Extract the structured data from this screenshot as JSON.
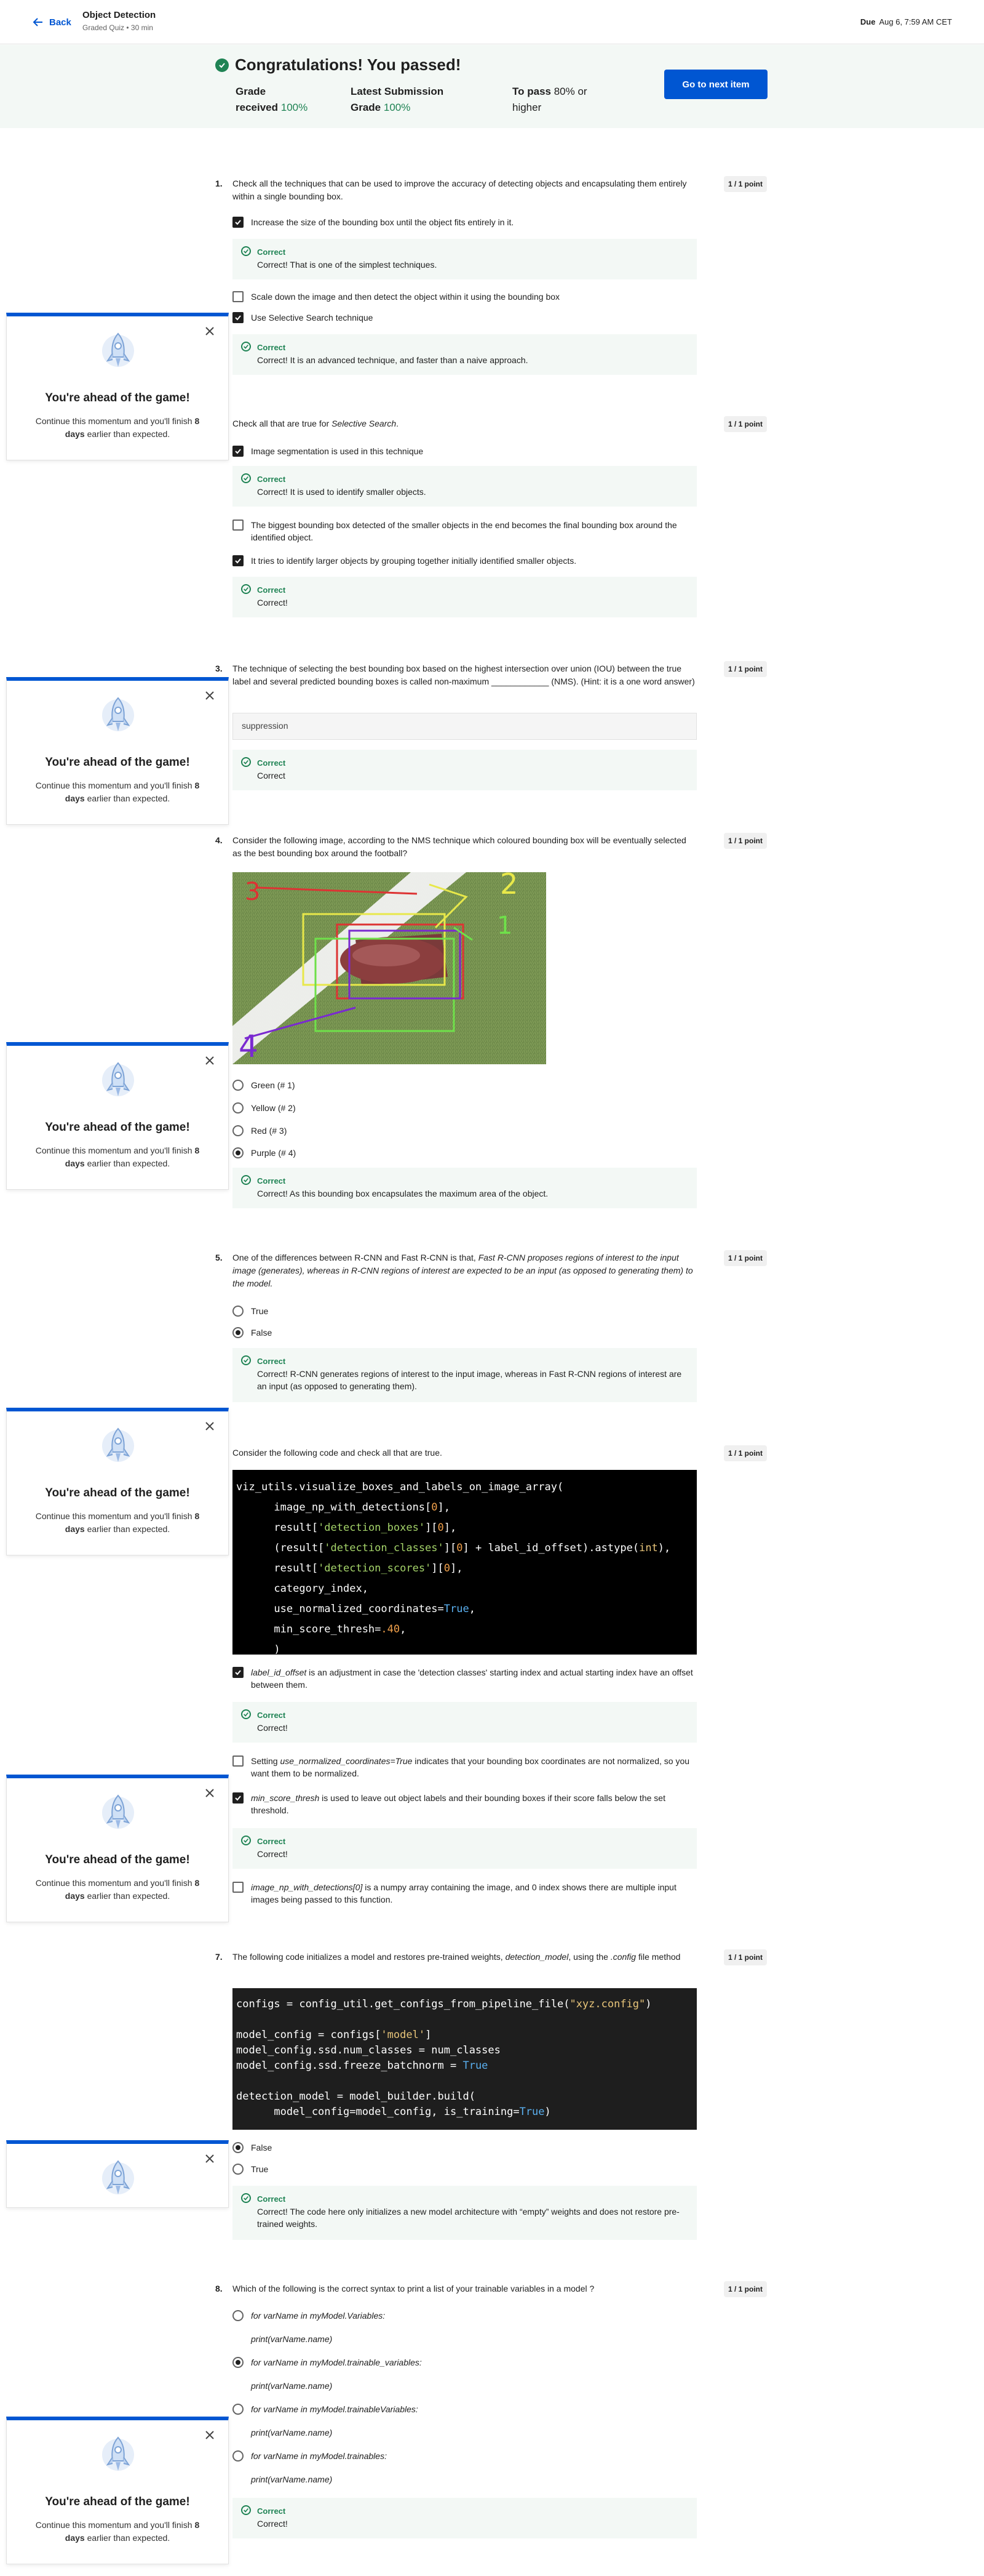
{
  "header": {
    "back_label": "Back",
    "course_title": "Object Detection",
    "course_subtitle": "Graded Quiz • 30 min",
    "due_label": "Due",
    "due_date": "Aug 6, 7:59 AM CET"
  },
  "banner": {
    "title": "Congratulations! You passed!",
    "grade_label_1": "Grade",
    "grade_label_2": "received",
    "grade_value": "100%",
    "latest_label_1": "Latest Submission",
    "latest_label_2": "Grade",
    "latest_value": "100%",
    "pass_label_1": "To pass",
    "pass_value": "80% or",
    "pass_label_2": "higher",
    "next_button": "Go to next item"
  },
  "side_card": {
    "title": "You're ahead of the game!",
    "line1": "Continue this momentum and you'll finish",
    "days": "8 days",
    "line2": "earlier than expected."
  },
  "points_label": "1 / 1 point",
  "correct_label": "Correct",
  "q1": {
    "num": "1.",
    "text": "Check all the techniques that can be used to improve the accuracy of detecting objects and encapsulating them entirely within a single bounding box.",
    "opt1": "Increase the size of the bounding box until the object fits entirely in it.",
    "fb1": "Correct! That is one of the simplest techniques.",
    "opt2": "Scale down the image and then detect the object within it using the bounding box",
    "opt3": "Use Selective Search technique",
    "fb3": "Correct! It is an advanced technique, and faster than a naive approach."
  },
  "q2": {
    "text_pre": "Check all that are true for ",
    "text_em": "Selective Search",
    "text_post": ".",
    "opt1": "Image segmentation is used in this technique",
    "fb1": "Correct! It is used to identify smaller objects.",
    "opt2": "The biggest bounding box detected of the smaller objects in the end becomes the final bounding box around the identified object.",
    "opt3": "It tries to identify larger objects by grouping together initially identified smaller objects.",
    "fb3": "Correct!"
  },
  "q3": {
    "num": "3.",
    "text": "The technique of selecting the best bounding box based on the highest intersection over union (IOU) between the true label and several predicted bounding boxes is called non-maximum ____________ (NMS). (Hint: it is a one word answer)",
    "answer": "suppression",
    "fb": "Correct"
  },
  "q4": {
    "num": "4.",
    "text": "Consider the following image, according to the NMS technique which coloured bounding box will be eventually selected as the best bounding box around the football?",
    "box_labels": [
      "1",
      "2",
      "3",
      "4"
    ],
    "opt1": "Green (# 1)",
    "opt2": "Yellow (# 2)",
    "opt3": "Red (# 3)",
    "opt4": "Purple (# 4)",
    "fb": "Correct! As this bounding box encapsulates the maximum area of the object."
  },
  "q5": {
    "num": "5.",
    "text_pre": "One of the differences between R-CNN and Fast R-CNN is that, ",
    "text_em": "Fast R-CNN proposes regions of interest to the input image (generates), whereas in R-CNN regions of interest are expected to be an input (as opposed to generating them) to the model.",
    "opt1": "True",
    "opt2": "False",
    "fb": "Correct! R-CNN generates regions of interest to the input image, whereas in Fast R-CNN regions of interest are an input (as opposed to generating them)."
  },
  "q6": {
    "text": "Consider the following code and check all that are true.",
    "opt1_em": "label_id_offset",
    "opt1": " is an adjustment in case the 'detection classes' starting index and actual starting index have an offset between them.",
    "fb1": "Correct!",
    "opt2_pre": "Setting ",
    "opt2_em": "use_normalized_coordinates=True",
    "opt2": " indicates that your bounding box coordinates are not normalized, so you want them to be normalized.",
    "opt3_em": "min_score_thresh",
    "opt3": " is used to leave out object labels and their bounding boxes if their score falls below the set threshold.",
    "fb3": "Correct!",
    "opt4_em": "image_np_with_detections[0]",
    "opt4": " is a numpy array containing the image, and 0 index shows there are multiple input images being passed to this function."
  },
  "q7": {
    "num": "7.",
    "text_pre": "The following code initializes a model and restores pre-trained weights, ",
    "text_em": "detection_model",
    "text_mid": ", using the ",
    "text_em2": ".config",
    "text_post": " file method",
    "opt1": "False",
    "opt2": "True",
    "fb": "Correct! The code here only initializes a new model architecture with “empty” weights and does not restore pre-trained weights."
  },
  "q8": {
    "num": "8.",
    "text": "Which of the following is the correct syntax to print a list of your trainable variables in a model ?",
    "opt1a": "for varName in myModel.Variables:",
    "opt1b": "print(varName.name)",
    "opt2a": "for varName in myModel.trainable_variables:",
    "opt2b": "print(varName.name)",
    "opt3a": "for varName in myModel.trainableVariables:",
    "opt3b": "print(varName.name)",
    "opt4a": "for varName in myModel.trainables:",
    "opt4b": "print(varName.name)",
    "fb": "Correct!"
  },
  "colors": {
    "accent": "#0056d2",
    "success": "#1f8354",
    "banner_bg": "#f3f8f5"
  }
}
